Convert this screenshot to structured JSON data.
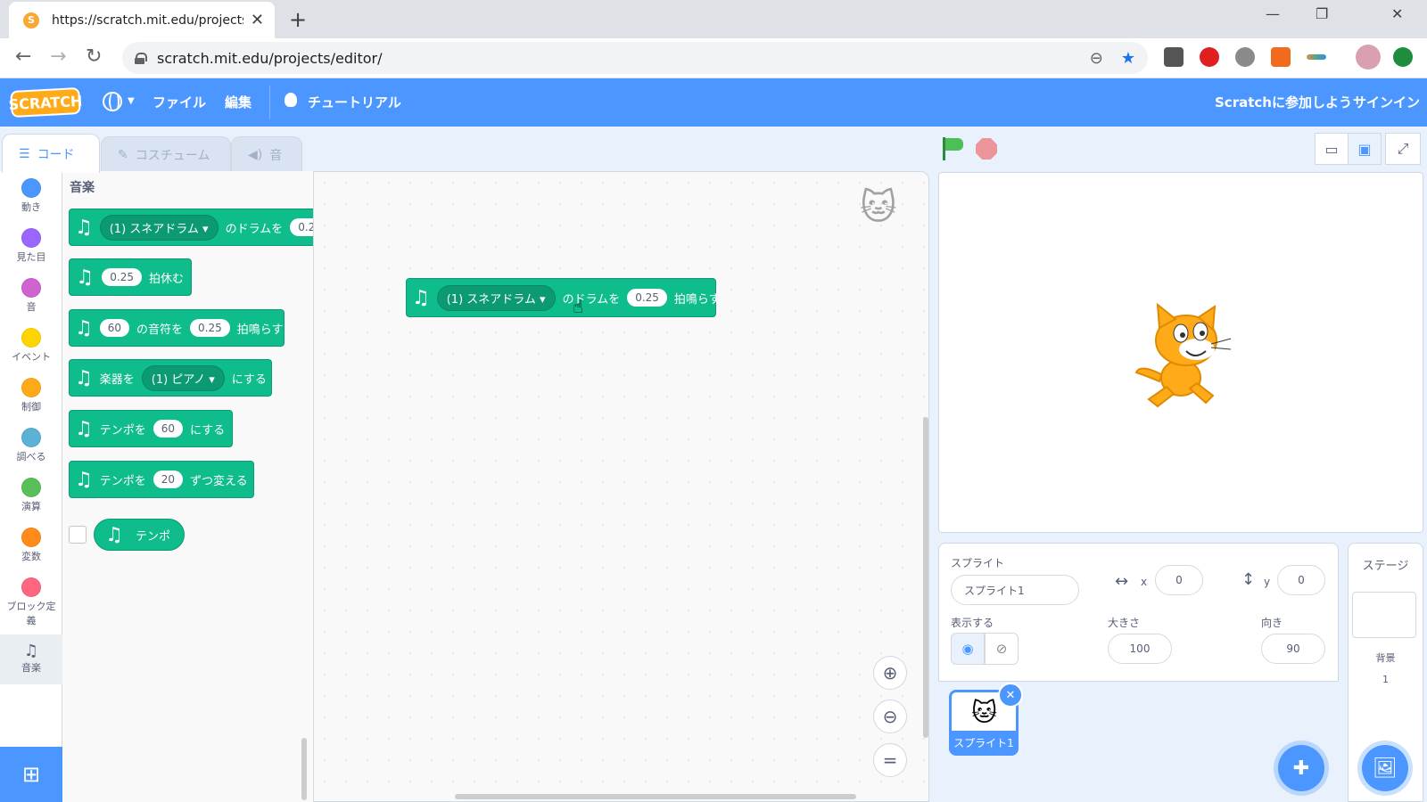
{
  "browser": {
    "tab_title": "https://scratch.mit.edu/projects/e",
    "tab_close": "✕",
    "new_tab": "+",
    "url": "scratch.mit.edu/projects/editor/",
    "win_min": "—",
    "win_restore": "❐",
    "win_close": "✕",
    "back": "←",
    "forward": "→",
    "reload": "↻"
  },
  "menubar": {
    "logo": "SCRATCH",
    "file": "ファイル",
    "edit": "編集",
    "tutorials": "チュートリアル",
    "join": "Scratchに参加しよう",
    "signin": "サインイン"
  },
  "tabs": {
    "code": "コード",
    "costumes": "コスチューム",
    "sounds": "音"
  },
  "categories": [
    {
      "label": "動き",
      "color": "#4c97ff"
    },
    {
      "label": "見た目",
      "color": "#9966ff"
    },
    {
      "label": "音",
      "color": "#cf63cf"
    },
    {
      "label": "イベント",
      "color": "#ffd500"
    },
    {
      "label": "制御",
      "color": "#ffab19"
    },
    {
      "label": "調べる",
      "color": "#5cb1d6"
    },
    {
      "label": "演算",
      "color": "#59c059"
    },
    {
      "label": "変数",
      "color": "#ff8c1a"
    },
    {
      "label": "ブロック定義",
      "color": "#ff6680"
    },
    {
      "label": "音楽",
      "color": ""
    }
  ],
  "flyout": {
    "title": "音楽",
    "blocks": {
      "drum": {
        "drop": "(1) スネアドラム ▾",
        "text": "のドラムを",
        "value": "0.2"
      },
      "rest": {
        "value": "0.25",
        "text": "拍休む"
      },
      "note": {
        "value1": "60",
        "text1": "の音符を",
        "value2": "0.25",
        "text2": "拍鳴らす"
      },
      "instrument": {
        "text1": "楽器を",
        "drop": "(1) ピアノ ▾",
        "text2": "にする"
      },
      "tempo_set": {
        "text1": "テンポを",
        "value": "60",
        "text2": "にする"
      },
      "tempo_change": {
        "text1": "テンポを",
        "value": "20",
        "text2": "ずつ変える"
      },
      "tempo_reporter": {
        "text": "テンポ"
      }
    }
  },
  "canvas_block": {
    "drop": "(1) スネアドラム ▾",
    "text1": "のドラムを",
    "value": "0.25",
    "text2": "拍鳴らす"
  },
  "sprite_info": {
    "sprite_label": "スプライト",
    "sprite_name": "スプライト1",
    "x_label": "x",
    "x_value": "0",
    "y_label": "y",
    "y_value": "0",
    "show_label": "表示する",
    "size_label": "大きさ",
    "size_value": "100",
    "direction_label": "向き",
    "direction_value": "90",
    "thumb_name": "スプライト1"
  },
  "stage_pane": {
    "title": "ステージ",
    "backdrops_label": "背景",
    "backdrops_count": "1"
  }
}
